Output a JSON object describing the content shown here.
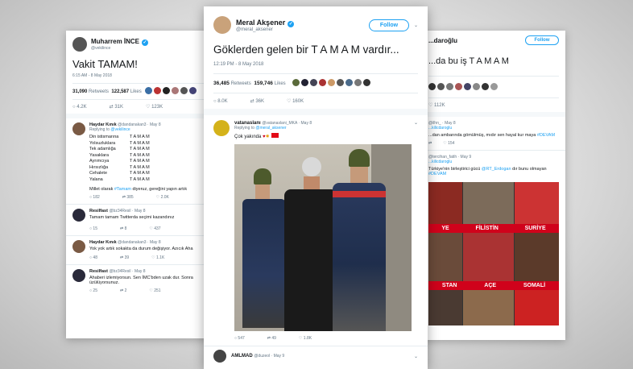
{
  "left": {
    "name": "Muharrem İNCE",
    "handle": "@vekilince",
    "text": "Vakit TAMAM!",
    "time": "6:15 AM - 8 May 2018",
    "retweets": "31,090",
    "retweets_label": "Retweets",
    "likes": "122,587",
    "likes_label": "Likes",
    "actions": [
      "4.2K",
      "31K",
      "123K"
    ],
    "reply1": {
      "name": "Haydar Kınık",
      "handle": "@dandanakan3 · May 8",
      "replying_prefix": "Replying to",
      "replying_to": "@vekilince",
      "lines": [
        [
          "Din istismarına",
          "T A M A M"
        ],
        [
          "Yolsuzluklara",
          "T A M A M"
        ],
        [
          "Tek adamlığa",
          "T A M A M"
        ],
        [
          "Yasaklara",
          "T A M A M"
        ],
        [
          "Ayrımcıya",
          "T A M A M"
        ],
        [
          "Hırsızlığa",
          "T A M A M"
        ],
        [
          "Cehalete",
          "T A M A M"
        ],
        [
          "Yalana",
          "T A M A M"
        ]
      ],
      "footer_pre": "Millet olarak",
      "footer_tag": "#Tamam",
      "footer_post": "diyeruz, gereğini yapın artık",
      "actions": [
        "182",
        "385",
        "2.0K"
      ]
    },
    "reply2": {
      "name": "Resilfast",
      "handle": "@bz34Resil · May 8",
      "text": "Tamam tamam Twitterda seçimi kazandınız",
      "actions": [
        "15",
        "8",
        "437"
      ]
    },
    "reply3": {
      "name": "Haydar Kınık",
      "handle": "@dandanakan3 · May 8",
      "text": "Yok yok artık sokakta da durum değişiyor. Azıcık Aha",
      "actions": [
        "48",
        "39",
        "1.1K"
      ]
    },
    "reply4": {
      "name": "Resilfast",
      "handle": "@bz34Resil · May 8",
      "text": "Ahaberi izlemiyorsun. Sen İMC'bden uzak dur. Sonra üzülüyorsunuz.",
      "actions": [
        "25",
        "2",
        "251"
      ]
    }
  },
  "center": {
    "name": "Meral Akşener",
    "handle": "@meral_aksener",
    "follow": "Follow",
    "text": "Göklerden gelen bir T A M A M vardır...",
    "time": "12:19 PM - 8 May 2018",
    "retweets": "36,485",
    "retweets_label": "Retweets",
    "likes": "159,746",
    "likes_label": "Likes",
    "actions": [
      "8.0K",
      "36K",
      "160K"
    ],
    "reply": {
      "name": "vatanaslanı",
      "handle": "@vatanaslani_MKA · May 8",
      "replying_prefix": "Replying to",
      "replying_to": "@meral_aksener",
      "text": "Çok yakında",
      "actions": [
        "547",
        "49",
        "1.8K"
      ]
    },
    "next": {
      "name": "AMLMAD",
      "handle": "@duzeol · May 9"
    }
  },
  "right": {
    "name": "...daroğlu",
    "follow": "Follow",
    "text": "...da bu iş T A M A M",
    "actions": [
      "",
      "",
      "112K"
    ],
    "reply1": {
      "handle": "@ilhn_ · May 8",
      "replying": "...kilicdaroglu",
      "text": "...dan ambarında gömülmüş, mıdır sen hayal kur maya",
      "tag": "#DEVAM",
      "actions": [
        "",
        "154"
      ]
    },
    "reply2": {
      "handle": "@tercihan_fatih · May 9",
      "replying": "...kilicdaroglu",
      "text": "Türkiye'nin birleştirici gücü",
      "mention": "@RT_Erdogan",
      "text2": "dır bunu olmayan",
      "tag": "#DEVAM"
    },
    "grid_labels": [
      "YE",
      "FİLİSTİN",
      "SURİYE",
      "STAN",
      "AÇE",
      "SOMALİ"
    ]
  },
  "colors": {
    "blue": "#1da1f2",
    "red_banner": "#d0021b",
    "gray_text": "#657786"
  }
}
